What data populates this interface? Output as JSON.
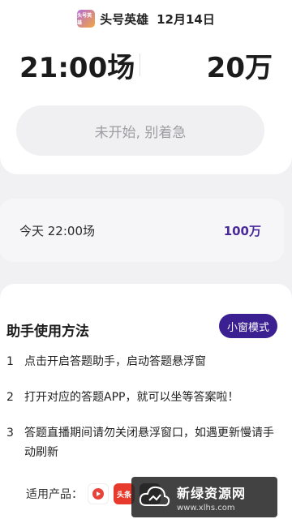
{
  "header": {
    "logo_text": "头号英雄",
    "app_name": "头号英雄",
    "date": "12月14日"
  },
  "current_round": {
    "time": "21:00场",
    "prize": "20万",
    "status_button": "未开始, 别着急"
  },
  "next_round": {
    "label": "今天 22:00场",
    "prize": "100万"
  },
  "help": {
    "title": "助手使用方法",
    "mode_button": "小窗模式",
    "steps": [
      {
        "num": "1",
        "text": "点击开启答题助手，启动答题悬浮窗"
      },
      {
        "num": "2",
        "text": "打开对应的答题APP，就可以坐等答案啦！"
      },
      {
        "num": "3",
        "text": "答题直播期间请勿关闭悬浮窗口，如遇更新慢请手动刷新"
      }
    ],
    "products_label": "适用产品：",
    "product_icons": [
      "xigua-icon",
      "toutiao-icon",
      "other-app-icon"
    ],
    "toutiao_label": "头条"
  },
  "watermark": {
    "title": "新绿资源网",
    "url": "www.xlhs.com"
  },
  "colors": {
    "accent": "#3a2091",
    "prize_text": "#4a2a9a",
    "button_bg": "#f0f0f2"
  }
}
